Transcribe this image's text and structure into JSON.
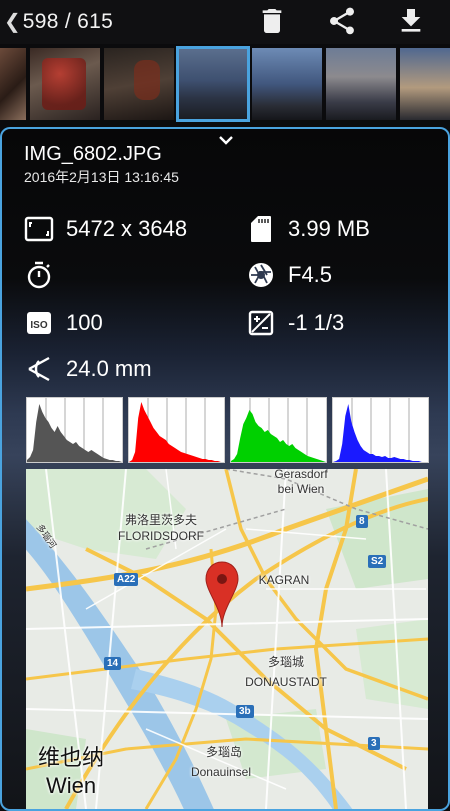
{
  "toolbar": {
    "counter": "598 / 615",
    "icons": [
      "back-chevron-icon",
      "trash-icon",
      "share-icon",
      "download-icon"
    ]
  },
  "thumbnails": {
    "selected_index": 3,
    "count_visible": 7
  },
  "info": {
    "filename": "IMG_6802.JPG",
    "datetime": "2016年2月13日 13:16:45",
    "resolution": "5472 x 3648",
    "file_size": "3.99 MB",
    "shutter": "",
    "aperture": "F4.5",
    "iso": "100",
    "exposure_comp": "-1 1/3",
    "focal_length": "24.0 mm"
  },
  "histograms": [
    {
      "channel": "luminance",
      "color": "#555555"
    },
    {
      "channel": "red",
      "color": "#ff0000"
    },
    {
      "channel": "green",
      "color": "#00d000"
    },
    {
      "channel": "blue",
      "color": "#1a1aff"
    }
  ],
  "map": {
    "labels": {
      "gerasdorf": "Gerasdorf\nbei Wien",
      "floridsdorf_cn": "弗洛里茨多夫",
      "floridsdorf": "FLORIDSDORF",
      "kagran": "KAGRAN",
      "donaustadt_cn": "多瑙城",
      "donaustadt": "DONAUSTADT",
      "donauinsel_cn": "多瑙岛",
      "donauinsel": "Donauinsel",
      "wien_cn": "维也纳",
      "wien": "Wien",
      "river": "多瑙河"
    },
    "badges": {
      "a22": "A22",
      "r14": "14",
      "r8": "8",
      "s2": "S2",
      "r3b": "3b",
      "r3": "3"
    },
    "colors": {
      "pin": "#d93025",
      "highway": "#f6c64a",
      "water": "#9cc6e8",
      "park": "#c4e2c0"
    }
  }
}
